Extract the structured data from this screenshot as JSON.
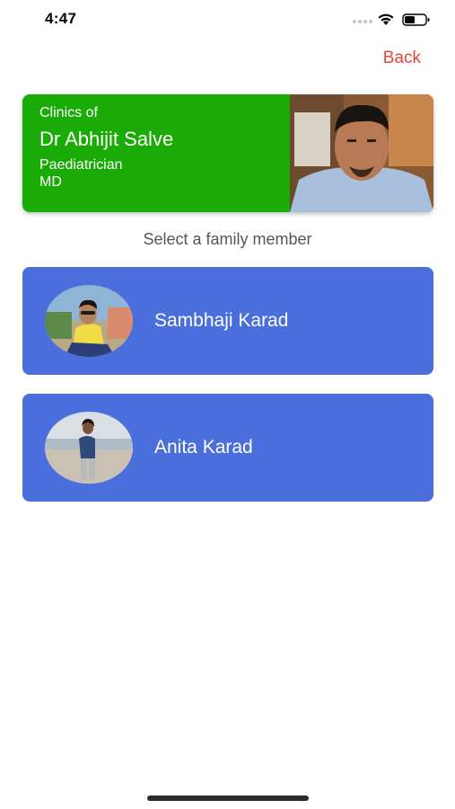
{
  "status_bar": {
    "time": "4:47"
  },
  "nav": {
    "back_label": "Back"
  },
  "doctor": {
    "clinics_label": "Clinics of",
    "name": "Dr Abhijit Salve",
    "specialty": "Paediatrician",
    "degree": "MD",
    "card_color": "#1aab06"
  },
  "family": {
    "heading": "Select a family member",
    "card_color": "#4a6fdc",
    "members": [
      {
        "name": "Sambhaji Karad"
      },
      {
        "name": "Anita Karad"
      }
    ]
  },
  "colors": {
    "accent_back": "#e5463a"
  }
}
